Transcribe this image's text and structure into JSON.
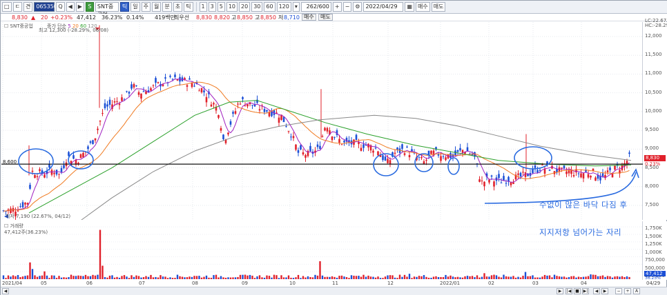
{
  "toolbar": {
    "btn_a": "□",
    "btn_b": "ㄷ",
    "btn_c": "견",
    "stock_code": "065350",
    "name_btn": "SNT중공업",
    "btn_search": "Q",
    "btn_prev": "◀",
    "btn_next": "▶",
    "periods": [
      "틱",
      "일",
      "주",
      "월",
      "분",
      "초",
      "틱"
    ],
    "minutes": [
      "1",
      "3",
      "5",
      "10",
      "20",
      "30",
      "60",
      "120"
    ],
    "zoom_value": "262/600",
    "date_value": "2022/04/29",
    "trade_btn_buy": "매수",
    "trade_btn_sell": "매도"
  },
  "quote": {
    "price": "8,830",
    "change": "20",
    "change_pct": "+0.23%",
    "volume": "47,412",
    "vol_ratio": "36.23%",
    "turnover_pct": "0.14%",
    "turnover_amt": "419백만",
    "ask_label": "최우선",
    "ask": "8,830",
    "bid": "8,820",
    "high_label": "고",
    "high": "8,850",
    "low_label": "고",
    "low": "8,850",
    "low2_label": "저",
    "low2": "8,710"
  },
  "price_pane": {
    "title": "SNT중공업",
    "ma_legend_label": "종가 단순",
    "ma_periods": [
      "5",
      "20",
      "60",
      "120"
    ],
    "ma_colors": [
      "#a020c0",
      "#f07a20",
      "#2aa02a",
      "#888888"
    ],
    "max_label": "최고 12,300 (-28.29%, 06/08)",
    "min_label": "최저 7,190 (22.67%, 04/12)",
    "support_label": "8,600",
    "support_value": 8600,
    "lc_label": "LC:22.67",
    "hc_label": "HC:-28.29",
    "last_price_tag": "8,830",
    "last_pct_tag": "0.23%",
    "y_ticks": [
      "12,000",
      "11,500",
      "11,000",
      "10,500",
      "10,000",
      "9,500",
      "9,000",
      "8,500",
      "8,000",
      "7,500"
    ],
    "y_values": [
      12000,
      11500,
      11000,
      10500,
      10000,
      9500,
      9000,
      8500,
      8000,
      7500
    ]
  },
  "volume_pane": {
    "title": "거래량",
    "value_label": "47,412주(36.23%)",
    "y_ticks": [
      "1,750K",
      "1,500K",
      "1,250K",
      "1,000K",
      "750,000",
      "500,000",
      "250,000"
    ],
    "last_tag": "47,412",
    "last_pct": "36.23%"
  },
  "x_axis": {
    "labels": [
      "2021/04",
      "05",
      "06",
      "07",
      "08",
      "09",
      "10",
      "11",
      "12",
      "2022/01",
      "02",
      "03",
      "04"
    ],
    "right_label": "04/29"
  },
  "annotations": {
    "line1": "수없이 많은 바닥 다짐 후",
    "line2": "지지저항 넘어가는 자리",
    "color": "#2a6be0"
  },
  "colors": {
    "up": "#e0202a",
    "down": "#1b4fd6"
  }
}
